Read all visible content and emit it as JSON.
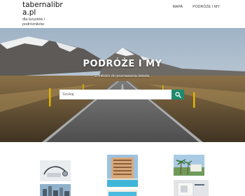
{
  "site": {
    "title": "tabernalibra.pl",
    "tagline": "dla turystów i podróżników"
  },
  "nav": {
    "items": [
      {
        "label": "MAPA"
      },
      {
        "label": "PODRÓŻE I MY"
      }
    ]
  },
  "hero": {
    "title": "PODRÓŻE I MY",
    "subtitle": "Z miłości do poznawania świata."
  },
  "search": {
    "placeholder": "Szukaj",
    "value": "",
    "button_icon": "search-icon"
  },
  "thumbnails": [
    {
      "subject": "stethoscope-image"
    },
    {
      "subject": "hotel-pool-image"
    },
    {
      "subject": "palm-resort-image"
    },
    {
      "subject": "city-skyline-image"
    },
    {
      "subject": "pool-deck-image"
    },
    {
      "subject": "boarding-pass-image"
    }
  ],
  "colors": {
    "accent": "#1e8a6e",
    "hero_sky": "#b9c8d6",
    "road": "#6b6b6b"
  }
}
